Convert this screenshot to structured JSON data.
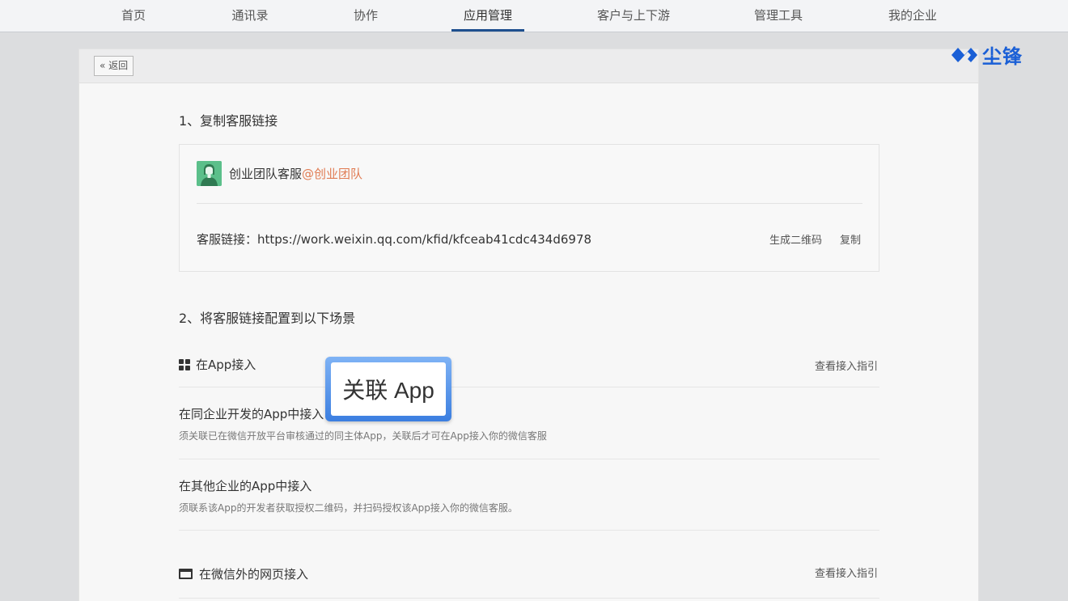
{
  "nav": {
    "items": [
      {
        "label": "首页"
      },
      {
        "label": "通讯录"
      },
      {
        "label": "协作"
      },
      {
        "label": "应用管理"
      },
      {
        "label": "客户与上下游"
      },
      {
        "label": "管理工具"
      },
      {
        "label": "我的企业"
      }
    ],
    "active": "应用管理"
  },
  "brand": {
    "text": "尘锋",
    "color": "#1a5fd6"
  },
  "header": {
    "back_label": "« 返回"
  },
  "section1": {
    "title": "1、复制客服链接",
    "account": {
      "name": "创业团队客服",
      "org": "@创业团队",
      "avatar_icon": "person-avatar-icon"
    },
    "link_label": "客服链接：",
    "link_url": "https://work.weixin.qq.com/kfid/kfceab41cdc434d6978",
    "qr_action": "生成二维码",
    "copy_action": "复制"
  },
  "section2": {
    "title": "2、将客服链接配置到以下场景",
    "app": {
      "title": "在App接入",
      "guide": "查看接入指引",
      "options": [
        {
          "title": "在同企业开发的App中接入",
          "desc": "须关联已在微信开放平台审核通过的同主体App，关联后才可在App接入你的微信客服"
        },
        {
          "title": "在其他企业的App中接入",
          "desc": "须联系该App的开发者获取授权二维码，并扫码授权该App接入你的微信客服。"
        }
      ]
    },
    "web": {
      "title": "在微信外的网页接入",
      "guide": "查看接入指引"
    }
  },
  "callout": {
    "label": "关联 App"
  },
  "colors": {
    "accent": "#1e4f8e",
    "org_highlight": "#e07b52",
    "callout_border": "#3b7ee0"
  }
}
